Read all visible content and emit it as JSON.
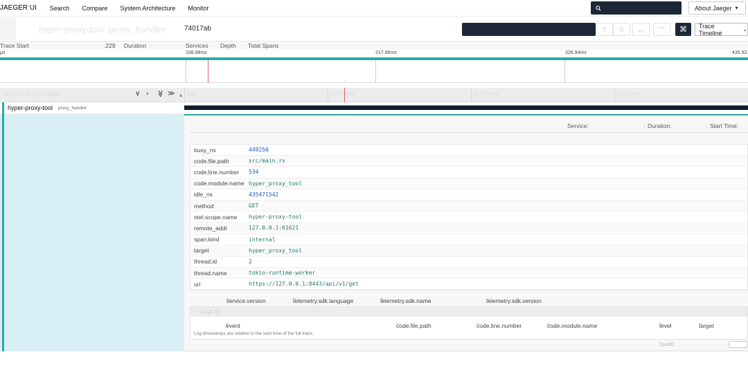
{
  "nav": {
    "brand": "JAEGER UI",
    "items": [
      "Search",
      "Compare",
      "System Architecture",
      "Monitor"
    ],
    "search_icon": "search-icon",
    "about_label": "About Jaeger",
    "about_icon": "chevron-down-icon"
  },
  "trace_header": {
    "title": "hyper-proxy-tool: proxy_handler",
    "trace_id": "74017ab",
    "help_icon": "?",
    "diamond_icon": "◇",
    "prev_icon": "︿",
    "next_icon": "﹀",
    "shortcut_icon": "⌘",
    "view_label": "Trace Timeline"
  },
  "summary": {
    "trace_start_label": "Trace Start",
    "trace_start_value": ".229",
    "duration_label": "Duration",
    "services_label": "Services",
    "depth_label": "Depth",
    "total_spans_label": "Total Spans"
  },
  "ruler": {
    "ticks": [
      "μs",
      "108.98ms",
      "217.96ms",
      "326.94ms",
      "435.92"
    ]
  },
  "span_header": {
    "title": "Service & Operation",
    "controls": [
      "∨",
      "›",
      "≫",
      "≫"
    ],
    "cols": [
      "0μs",
      "108.98ms",
      "217.96ms",
      "326.94ms"
    ]
  },
  "span": {
    "service": "hyper-proxy-tool",
    "operation": "proxy_handler"
  },
  "detail": {
    "service_label": "Service:",
    "duration_label": "Duration:",
    "start_label": "Start Time:",
    "tags": [
      {
        "key": "busy_ns",
        "value": "449250",
        "kind": "num"
      },
      {
        "key": "code.file.path",
        "value": "src/main.rs",
        "kind": "str"
      },
      {
        "key": "code.line.number",
        "value": "534",
        "kind": "num"
      },
      {
        "key": "code.module.name",
        "value": "hyper_proxy_tool",
        "kind": "str"
      },
      {
        "key": "idle_ns",
        "value": "435471542",
        "kind": "num"
      },
      {
        "key": "method",
        "value": "GET",
        "kind": "str"
      },
      {
        "key": "otel.scope.name",
        "value": "hyper-proxy-tool",
        "kind": "str"
      },
      {
        "key": "remote_addr",
        "value": "127.0.0.1:61621",
        "kind": "str"
      },
      {
        "key": "span.kind",
        "value": "internal",
        "kind": "str"
      },
      {
        "key": "target",
        "value": "hyper_proxy_tool",
        "kind": "str"
      },
      {
        "key": "thread.id",
        "value": "2",
        "kind": "num"
      },
      {
        "key": "thread.name",
        "value": "tokio-runtime-worker",
        "kind": "str"
      },
      {
        "key": "uri",
        "value": "https://127.0.0.1:8443/api/v1/get",
        "kind": "str"
      }
    ],
    "process": [
      "service.version",
      "telemetry.sdk.language",
      "telemetry.sdk.name",
      "telemetry.sdk.version"
    ],
    "logs_title": "Logs (1)",
    "log_cols": [
      "event",
      "code.file.path",
      "code.line.number",
      "code.module.name",
      "level",
      "target"
    ],
    "logs_note": "Log timestamps are relative to the start time of the full trace.",
    "spanid_label": "SpanID:"
  }
}
